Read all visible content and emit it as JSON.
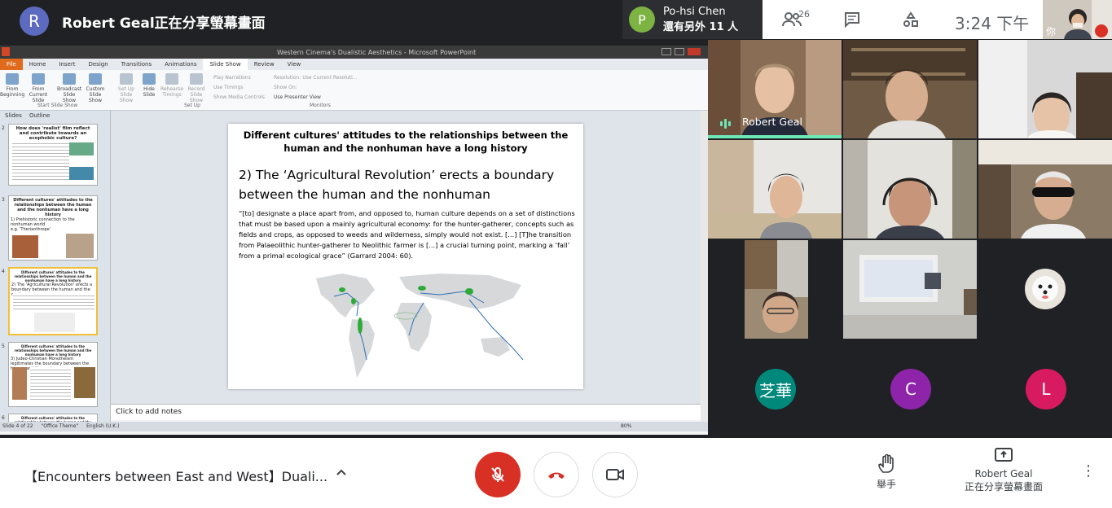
{
  "top_bar": {
    "presenter_initial": "R",
    "presenter_title": "Robert Geal正在分享螢幕畫面",
    "join_initial": "P",
    "join_name": "Po-hsi Chen",
    "join_others": "還有另外 11 人",
    "people_count": "26",
    "clock": "3:24 下午",
    "self_label": "你"
  },
  "powerpoint": {
    "window_title": "Western Cinema's Dualistic Aesthetics - Microsoft PowerPoint",
    "tabs": [
      "File",
      "Home",
      "Insert",
      "Design",
      "Transitions",
      "Animations",
      "Slide Show",
      "Review",
      "View"
    ],
    "active_tab": "Slide Show",
    "ribbon": {
      "from_beginning": "From Beginning",
      "from_current": "From Current Slide",
      "broadcast": "Broadcast Slide Show",
      "custom": "Custom Slide Show",
      "setup": "Set Up Slide Show",
      "hide": "Hide Slide",
      "rehearse": "Rehearse Timings",
      "record": "Record Slide Show",
      "play_narrations": "Play Narrations",
      "use_timings": "Use Timings",
      "show_media": "Show Media Controls",
      "resolution": "Resolution:",
      "resolution_value": "Use Current Resoluti...",
      "show_on": "Show On:",
      "presenter_view": "Use Presenter View",
      "group_start": "Start Slide Show",
      "group_setup": "Set Up",
      "group_monitors": "Monitors"
    },
    "left_tabs": [
      "Slides",
      "Outline"
    ],
    "thumbnails": [
      {
        "num": "2",
        "title": "How does 'realist' film reflect and contribute towards an ecophobic culture?"
      },
      {
        "num": "3",
        "title": "Different cultures' attitudes to the relationships between the human and the nonhuman have a long history",
        "sub": "1) Prehistoric connection to the nonhuman world",
        "eg": "e.g. 'Therianthrope'"
      },
      {
        "num": "4",
        "title": "Different cultures' attitudes to the relationships between the human and the nonhuman have a long history",
        "sub": "2) The 'Agricultural Revolution' erects a boundary between the human and the nonhuman"
      },
      {
        "num": "5",
        "title": "Different cultures' attitudes to the relationships between the human and the nonhuman have a long history",
        "sub": "3) Judeo-Christian Monotheism legitimates the boundary between the human and the nonhuman"
      },
      {
        "num": "6",
        "title": "Different cultures' attitudes to the relationships between the human and the nonhuman have a long history"
      }
    ],
    "slide": {
      "title": "Different cultures' attitudes to the relationships between the human and the nonhuman have a long history",
      "heading": "2) The ‘Agricultural Revolution’ erects a boundary between the human and the nonhuman",
      "quote": "“[to] designate a place apart from, and opposed to, human culture depends on a set of distinctions that must be based upon a mainly agricultural economy: for the hunter-gatherer, concepts such as fields and crops, as opposed to weeds and wilderness, simply would not exist. [...] [T]he transition from Palaeolithic hunter-gatherer to Neolithic farmer is [...] a crucial turning point, marking a ‘fall’ from a primal ecological grace” (Garrard 2004: 60)."
    },
    "notes_placeholder": "Click to add notes",
    "status": {
      "slide_of": "Slide 4 of 22",
      "theme": "\"Office Theme\"",
      "language": "English (U.K.)",
      "zoom": "80%"
    }
  },
  "participants": {
    "speaker_name": "Robert Geal",
    "avatars": [
      {
        "label": "芝華",
        "color": "#00897b"
      },
      {
        "label": "C",
        "color": "#8e24aa"
      },
      {
        "label": "L",
        "color": "#d81b60"
      }
    ]
  },
  "bottom_bar": {
    "meeting_title": "【Encounters between East and West】Duali...",
    "raise_hand": "舉手",
    "presenter_name": "Robert Geal",
    "presenting_label": "正在分享螢幕畫面"
  },
  "colors": {
    "end_call": "#d93025",
    "speaking_bar": "#6ee7b7"
  }
}
